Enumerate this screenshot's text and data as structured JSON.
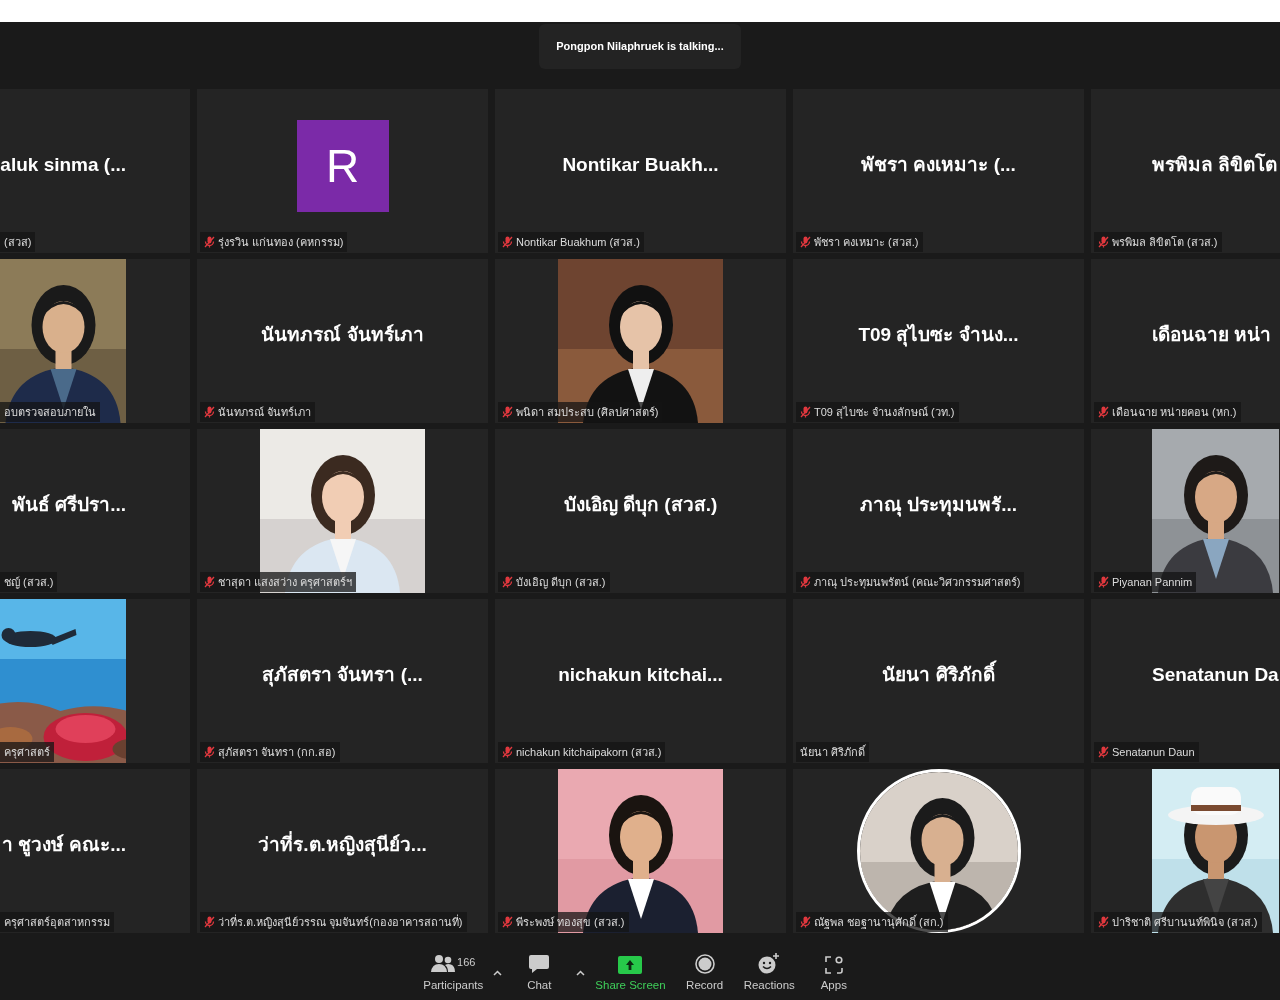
{
  "speaker_notice": {
    "text": "Pongpon Nilaphruek is talking..."
  },
  "tiles": [
    {
      "kind": "name",
      "display": "aluk sinma (...",
      "label": "(สวส)",
      "muted": false
    },
    {
      "kind": "avatar",
      "display": "R",
      "label": "รุ่งรวิน  แก่นทอง (คหกรรม)",
      "muted": true
    },
    {
      "kind": "name",
      "display": "Nontikar  Buakh...",
      "label": "Nontikar Buakhum  (สวส.)",
      "muted": true
    },
    {
      "kind": "name",
      "display": "พัชรา  คงเหมาะ (...",
      "label": "พัชรา  คงเหมาะ (สวส.)",
      "muted": true
    },
    {
      "kind": "name",
      "display": "พรพิมล ลิขิตโต",
      "label": "พรพิมล ลิขิตโต (สวส.)",
      "muted": true
    },
    {
      "kind": "picture",
      "label": "อบตรวจสอบภายใน",
      "muted": false
    },
    {
      "kind": "name",
      "display": "นันทภรณ์ จันทร์เภา",
      "label": "นันทภรณ์ จันทร์เภา",
      "muted": true
    },
    {
      "kind": "picture",
      "label": "พนิดา สมประสบ (ศิลปศาสตร์)",
      "muted": true
    },
    {
      "kind": "name",
      "display": "T09 สุไบซะ จำนง...",
      "label": "T09 สุไบซะ จำนงลักษณ์ (วท.)",
      "muted": true
    },
    {
      "kind": "name",
      "display": "เดือนฉาย หน่า",
      "label": "เดือนฉาย หน่ายคอน (หก.)",
      "muted": true
    },
    {
      "kind": "name",
      "display": "พันธ์ ศรีปรา...",
      "label": "ชญ์ (สวส.)",
      "muted": false
    },
    {
      "kind": "picture",
      "label": "ชาสุดา แสงสว่าง ครุศาสตร์ฯ",
      "muted": true
    },
    {
      "kind": "name",
      "display": "บังเอิญ ดีบุก (สวส.)",
      "label": "บังเอิญ ดีบุก (สวส.)",
      "muted": true
    },
    {
      "kind": "name",
      "display": "ภาณุ ประทุมนพรั...",
      "label": "ภาณุ ประทุมนพรัตน์ (คณะวิศวกรรมศาสตร์)",
      "muted": true
    },
    {
      "kind": "picture",
      "label": "Piyanan Pannim",
      "muted": true
    },
    {
      "kind": "picture",
      "label": "ครุศาสตร์",
      "muted": false
    },
    {
      "kind": "name",
      "display": "สุภัสตรา จันทรา (...",
      "label": "สุภัสตรา จันทรา (กก.สอ)",
      "muted": true
    },
    {
      "kind": "name",
      "display": "nichakun  kitchai...",
      "label": "nichakun kitchaipakorn (สวส.)",
      "muted": true
    },
    {
      "kind": "name",
      "display": "นัยนา ศิริภักดิ์",
      "label": "นัยนา ศิริภักดิ์",
      "muted": false
    },
    {
      "kind": "name",
      "display": "Senatanun Da",
      "label": "Senatanun Daun",
      "muted": true
    },
    {
      "kind": "name",
      "display": "า ชูวงษ์ คณะ...",
      "label": "ครุศาสตร์อุตสาหกรรม",
      "muted": false
    },
    {
      "kind": "name",
      "display": "ว่าที่ร.ต.หญิงสุนีย์ว...",
      "label": "ว่าที่ร.ต.หญิงสุนีย์วรรณ จุมจันทร์(กองอาคารสถานที่)",
      "muted": true
    },
    {
      "kind": "picture",
      "label": "พีระพงษ์ ทองสุข (สวส.)",
      "muted": true
    },
    {
      "kind": "round-picture",
      "label": "ณัฐพล ชอฐานานุศักดิ์ (สก.)",
      "muted": true
    },
    {
      "kind": "picture",
      "label": "ปาริชาติ ศรีบานนท์พินิจ (สวส.)",
      "muted": true
    }
  ],
  "toolbar": [
    {
      "kind": "participants",
      "label": "Participants",
      "count": "166",
      "menu": true
    },
    {
      "kind": "chat",
      "label": "Chat",
      "menu": true
    },
    {
      "kind": "share",
      "label": "Share Screen",
      "menu": false
    },
    {
      "kind": "record",
      "label": "Record",
      "menu": false
    },
    {
      "kind": "reactions",
      "label": "Reactions",
      "menu": false
    },
    {
      "kind": "apps",
      "label": "Apps",
      "menu": false
    }
  ]
}
